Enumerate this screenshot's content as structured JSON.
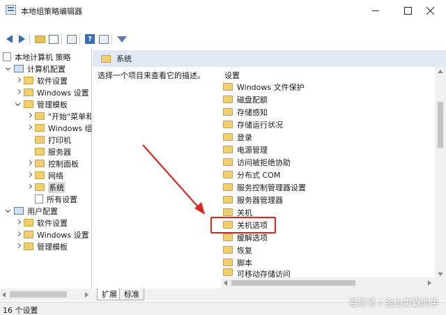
{
  "window": {
    "title": "本地组策略编辑器"
  },
  "toolbar": {
    "icons": [
      "back-arrow-icon",
      "forward-arrow-icon",
      "up-folder-icon",
      "show-hide-tree-icon",
      "export-list-icon",
      "help-icon",
      "properties-icon",
      "filter-icon"
    ]
  },
  "tree": {
    "items": [
      {
        "label": "本地计算机 策略"
      },
      {
        "label": "计算机配置"
      },
      {
        "label": "软件设置"
      },
      {
        "label": "Windows 设置"
      },
      {
        "label": "管理模板"
      },
      {
        "label": "\"开始\"菜单和"
      },
      {
        "label": "Windows 组"
      },
      {
        "label": "打印机"
      },
      {
        "label": "服务器"
      },
      {
        "label": "控制面板"
      },
      {
        "label": "网络"
      },
      {
        "label": "系统"
      },
      {
        "label": "所有设置"
      },
      {
        "label": "用户配置"
      },
      {
        "label": "软件设置"
      },
      {
        "label": "Windows 设置"
      },
      {
        "label": "管理模板"
      }
    ]
  },
  "main": {
    "header_title": "系统",
    "description": "选择一个项目来查看它的描述。",
    "column_header": "设置",
    "settings": [
      "Windows 文件保护",
      "磁盘配额",
      "存储感知",
      "存储运行状况",
      "登录",
      "电源管理",
      "访问被拒绝协助",
      "分布式 COM",
      "服务控制管理器设置",
      "服务器管理器",
      "关机",
      "关机选项",
      "缓解选项",
      "恢复",
      "脚本",
      "可移动存储访问"
    ],
    "highlighted": "关机选项"
  },
  "tabs": [
    {
      "label": "扩展"
    },
    {
      "label": "标准"
    }
  ],
  "status": {
    "text": "16 个设置"
  },
  "watermark": "百家号 / 金山毒霸助手",
  "colors": {
    "header_bg": "#dfe8f3",
    "highlight_border": "#e0241b",
    "annotation_arrow": "#e0241b",
    "folder": "#f0cf6e"
  }
}
